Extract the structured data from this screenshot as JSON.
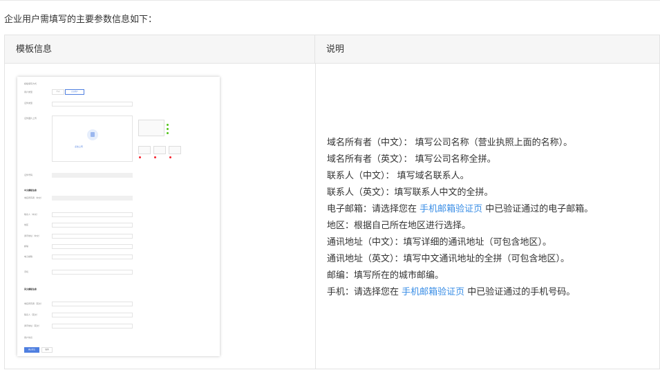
{
  "intro": "企业用户需填写的主要参数信息如下：",
  "table": {
    "col1_header": "模板信息",
    "col2_header": "说明"
  },
  "form_image": {
    "field_labels": [
      "模板填写方式",
      "用户类型",
      "证件类型",
      "证件图片上传",
      "证件号码",
      "中文模板信息",
      "域名所有者（中文）",
      "联系人（中文）",
      "地区",
      "通讯地址（中文）",
      "邮编",
      "电子邮箱",
      "手机",
      "英文模板信息",
      "域名所有者（英文）",
      "联系人（英文）",
      "通讯地址（英文）",
      "用户协议"
    ],
    "user_type_options": [
      "个人",
      "企业用户"
    ],
    "upload_text": "点击上传",
    "submit_label": "确认提交",
    "cancel_label": "取消"
  },
  "description": {
    "lines": [
      {
        "text": "域名所有者（中文）： 填写公司名称（营业执照上面的名称）。"
      },
      {
        "text": "域名所有者（英文）： 填写公司名称全拼。"
      },
      {
        "text": "联系人（中文）： 填写域名联系人。"
      },
      {
        "text": "联系人（英文）：填写联系人中文的全拼。"
      },
      {
        "pre": "电子邮箱：请选择您在 ",
        "link": "手机邮箱验证页",
        "post": " 中已验证通过的电子邮箱。"
      },
      {
        "text": "地区：根据自己所在地区进行选择。"
      },
      {
        "text": "通讯地址（中文）：填写详细的通讯地址（可包含地区）。"
      },
      {
        "text": "通讯地址（英文）：填写中文通讯地址的全拼（可包含地区）。"
      },
      {
        "text": "邮编：填写所在的城市邮编。"
      },
      {
        "pre": "手机：请选择您在 ",
        "link": "手机邮箱验证页",
        "post": " 中已验证通过的手机号码。"
      }
    ]
  },
  "colors": {
    "link": "#3a8ee6",
    "header_bg": "#f6f6f6",
    "primary": "#4f7fe0"
  }
}
